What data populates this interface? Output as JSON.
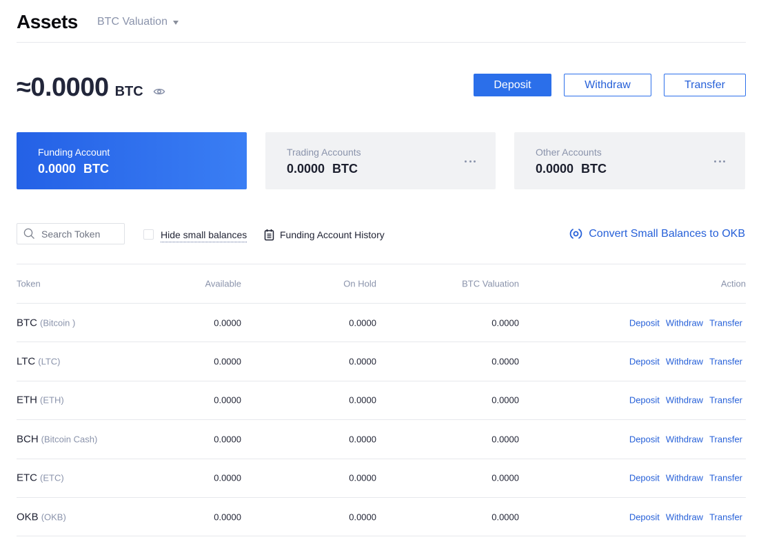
{
  "header": {
    "title": "Assets",
    "valuation_select": "BTC Valuation"
  },
  "summary": {
    "total_amount": "≈0.0000",
    "total_unit": "BTC",
    "visibility_icon": "eye-icon"
  },
  "buttons": {
    "deposit": "Deposit",
    "withdraw": "Withdraw",
    "transfer": "Transfer"
  },
  "accounts": [
    {
      "label": "Funding Account",
      "value": "0.0000  BTC",
      "selected": true
    },
    {
      "label": "Trading Accounts",
      "value": "0.0000  BTC",
      "selected": false
    },
    {
      "label": "Other Accounts",
      "value": "0.0000  BTC",
      "selected": false
    }
  ],
  "toolbar": {
    "search_placeholder": "Search Token",
    "search_value": "",
    "hide_small_balances_label": "Hide small balances",
    "hide_small_balances_checked": false,
    "history_label": "Funding Account History",
    "convert_label": "Convert Small Balances to OKB"
  },
  "table": {
    "headers": {
      "token": "Token",
      "available": "Available",
      "on_hold": "On Hold",
      "btc_valuation": "BTC Valuation",
      "action": "Action"
    },
    "action_labels": {
      "deposit": "Deposit",
      "withdraw": "Withdraw",
      "transfer": "Transfer"
    },
    "rows": [
      {
        "symbol": "BTC",
        "name": "(Bitcoin )",
        "available": "0.0000",
        "on_hold": "0.0000",
        "btc_valuation": "0.0000"
      },
      {
        "symbol": "LTC",
        "name": "(LTC)",
        "available": "0.0000",
        "on_hold": "0.0000",
        "btc_valuation": "0.0000"
      },
      {
        "symbol": "ETH",
        "name": "(ETH)",
        "available": "0.0000",
        "on_hold": "0.0000",
        "btc_valuation": "0.0000"
      },
      {
        "symbol": "BCH",
        "name": "(Bitcoin Cash)",
        "available": "0.0000",
        "on_hold": "0.0000",
        "btc_valuation": "0.0000"
      },
      {
        "symbol": "ETC",
        "name": "(ETC)",
        "available": "0.0000",
        "on_hold": "0.0000",
        "btc_valuation": "0.0000"
      },
      {
        "symbol": "OKB",
        "name": "(OKB)",
        "available": "0.0000",
        "on_hold": "0.0000",
        "btc_valuation": "0.0000"
      }
    ]
  },
  "colors": {
    "primary": "#2b6fea",
    "link": "#2660d8",
    "muted_text": "#8a93ab",
    "card_bg": "#f1f2f4"
  }
}
